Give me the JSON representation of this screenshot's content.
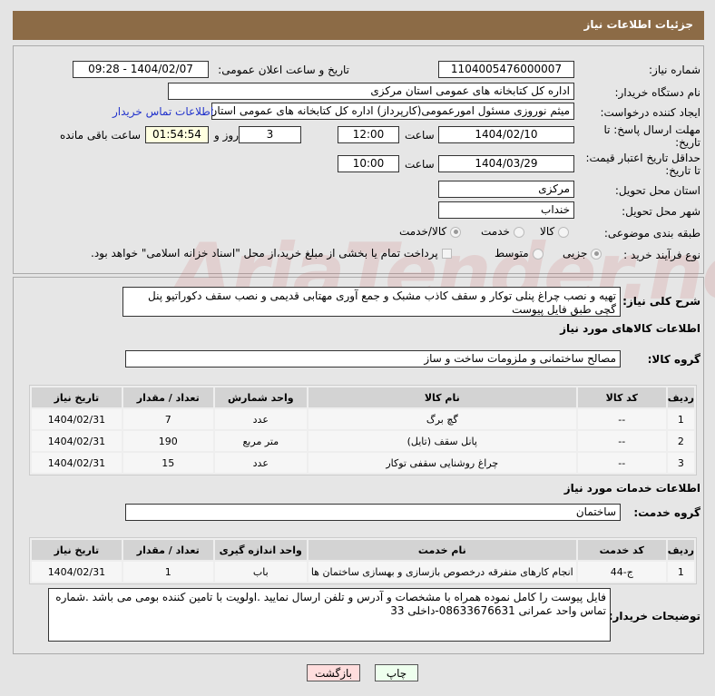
{
  "header": {
    "title": "جزئیات اطلاعات نیاز"
  },
  "form": {
    "need_number_label": "شماره نیاز:",
    "need_number": "1104005476000007",
    "announce_label": "تاریخ و ساعت اعلان عمومی:",
    "announce_value": "1404/02/07 - 09:28",
    "buyer_org_label": "نام دستگاه خریدار:",
    "buyer_org": "اداره کل کتابخانه های عمومی استان مرکزی",
    "creator_label": "ایجاد کننده درخواست:",
    "creator": "میثم نوروزی مسئول امورعمومی(کارپرداز) اداره کل کتابخانه های عمومی استان مرکزی",
    "contact_link": "اطلاعات تماس خریدار",
    "deadline_label": "مهلت ارسال پاسخ: تا تاریخ:",
    "deadline_date": "1404/02/10",
    "time_label": "ساعت",
    "deadline_time": "12:00",
    "days": "3",
    "days_label": "روز و",
    "remaining": "01:54:54",
    "remaining_label": "ساعت باقی مانده",
    "validity_label": "حداقل تاریخ اعتبار قیمت: تا تاریخ:",
    "validity_date": "1404/03/29",
    "validity_time": "10:00",
    "province_label": "استان محل تحویل:",
    "province": "مرکزی",
    "city_label": "شهر محل تحویل:",
    "city": "خنداب",
    "category_label": "طبقه بندی موضوعی:",
    "category_options": [
      "کالا",
      "خدمت",
      "کالا/خدمت"
    ],
    "process_label": "نوع فرآیند خرید :",
    "process_options": [
      "جزیی",
      "متوسط"
    ],
    "treasury_note": "پرداخت تمام یا بخشی از مبلغ خرید،از محل \"اسناد خزانه اسلامی\" خواهد بود."
  },
  "description": {
    "label": "شرح کلی نیاز:",
    "text": "تهیه و نصب چراغ پنلی توکار و سقف کاذب مشبک و جمع آوری مهتابی قدیمی و نصب سقف دکوراتیو پنل گچی طبق فایل پیوست"
  },
  "goods": {
    "title": "اطلاعات کالاهای مورد نیاز",
    "group_label": "گروه کالا:",
    "group": "مصالح ساختمانی و ملزومات ساخت و ساز",
    "columns": [
      "ردیف",
      "کد کالا",
      "نام کالا",
      "واحد شمارش",
      "تعداد / مقدار",
      "تاریخ نیاز"
    ],
    "rows": [
      [
        "1",
        "--",
        "گچ برگ",
        "عدد",
        "7",
        "1404/02/31"
      ],
      [
        "2",
        "--",
        "پانل سقف (تایل)",
        "متر مربع",
        "190",
        "1404/02/31"
      ],
      [
        "3",
        "--",
        "چراغ روشنایی سقفی توکار",
        "عدد",
        "15",
        "1404/02/31"
      ]
    ]
  },
  "services": {
    "title": "اطلاعات خدمات مورد نیاز",
    "group_label": "گروه خدمت:",
    "group": "ساختمان",
    "columns": [
      "ردیف",
      "کد خدمت",
      "نام خدمت",
      "واحد اندازه گیری",
      "تعداد / مقدار",
      "تاریخ نیاز"
    ],
    "rows": [
      [
        "1",
        "ج-44",
        "انجام کارهای متفرقه درخصوص بازسازی و بهسازی ساختمان ها",
        "باب",
        "1",
        "1404/02/31"
      ]
    ]
  },
  "buyer_notes": {
    "label": "توضیحات خریدار:",
    "text": "فایل پیوست را کامل نموده همراه با مشخصات و آدرس و تلفن ارسال نمایید .اولویت با تامین کننده بومی می باشد .شماره تماس واحد عمرانی 08633676631-داخلی 33"
  },
  "buttons": {
    "print": "چاپ",
    "back": "بازگشت"
  },
  "watermark": "AriaTender.net"
}
